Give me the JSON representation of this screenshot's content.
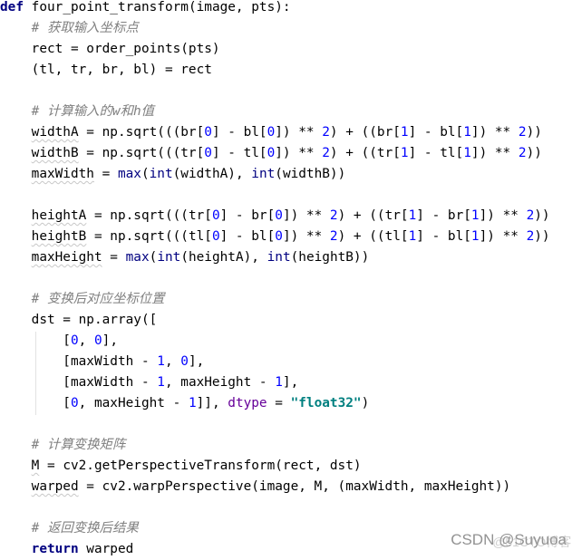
{
  "code": {
    "language": "python",
    "lines": [
      "def four_point_transform(image, pts):",
      "    # 获取输入坐标点",
      "    rect = order_points(pts)",
      "    (tl, tr, br, bl) = rect",
      "",
      "    # 计算输入的w和h值",
      "    widthA = np.sqrt(((br[0] - bl[0]) ** 2) + ((br[1] - bl[1]) ** 2))",
      "    widthB = np.sqrt(((tr[0] - tl[0]) ** 2) + ((tr[1] - tl[1]) ** 2))",
      "    maxWidth = max(int(widthA), int(widthB))",
      "",
      "    heightA = np.sqrt(((tr[0] - br[0]) ** 2) + ((tr[1] - br[1]) ** 2))",
      "    heightB = np.sqrt(((tl[0] - bl[0]) ** 2) + ((tl[1] - bl[1]) ** 2))",
      "    maxHeight = max(int(heightA), int(heightB))",
      "",
      "    # 变换后对应坐标位置",
      "    dst = np.array([",
      "        [0, 0],",
      "        [maxWidth - 1, 0],",
      "        [maxWidth - 1, maxHeight - 1],",
      "        [0, maxHeight - 1]], dtype = \"float32\")",
      "",
      "    # 计算变换矩阵",
      "    M = cv2.getPerspectiveTransform(rect, dst)",
      "    warped = cv2.warpPerspective(image, M, (maxWidth, maxHeight))",
      "",
      "    # 返回变换后结果",
      "    return warped"
    ]
  },
  "tokens": {
    "def": "def",
    "func_name": "four_point_transform",
    "params": "(image, pts):",
    "comment1": "# 获取输入坐标点",
    "comment2": "# 计算输入的w和h值",
    "comment3": "# 变换后对应坐标位置",
    "comment4": "# 计算变换矩阵",
    "comment5": "# 返回变换后结果",
    "return_kw": "return",
    "return_val": " warped",
    "float32": "\"float32\"",
    "dtype": "dtype"
  },
  "watermark": {
    "text": "CSDN @Suyuoa",
    "overlay": "@51CTO博客"
  },
  "colors": {
    "keyword": "#000080",
    "number": "#0000ff",
    "string": "#008080",
    "comment": "#808080",
    "kwarg": "#660099"
  }
}
